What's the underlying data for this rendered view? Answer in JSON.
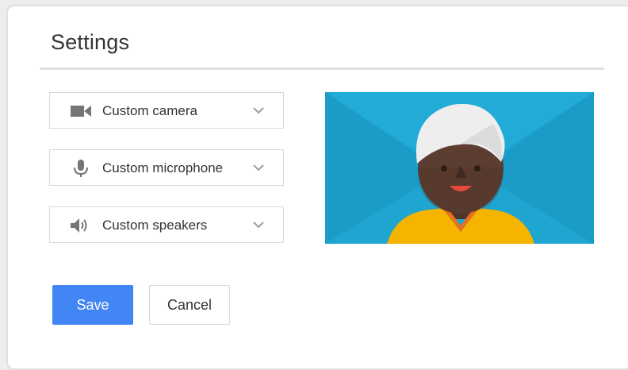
{
  "dialog": {
    "title": "Settings"
  },
  "devices": [
    {
      "icon": "camera-icon",
      "label": "Custom camera"
    },
    {
      "icon": "microphone-icon",
      "label": "Custom microphone"
    },
    {
      "icon": "speaker-icon",
      "label": "Custom speakers"
    }
  ],
  "preview": {
    "icon": "avatar-preview-illustration"
  },
  "actions": {
    "save_label": "Save",
    "cancel_label": "Cancel"
  },
  "colors": {
    "accent": "#4285f4",
    "preview_background": "#1ea5d0",
    "icon_gray": "#757575"
  }
}
